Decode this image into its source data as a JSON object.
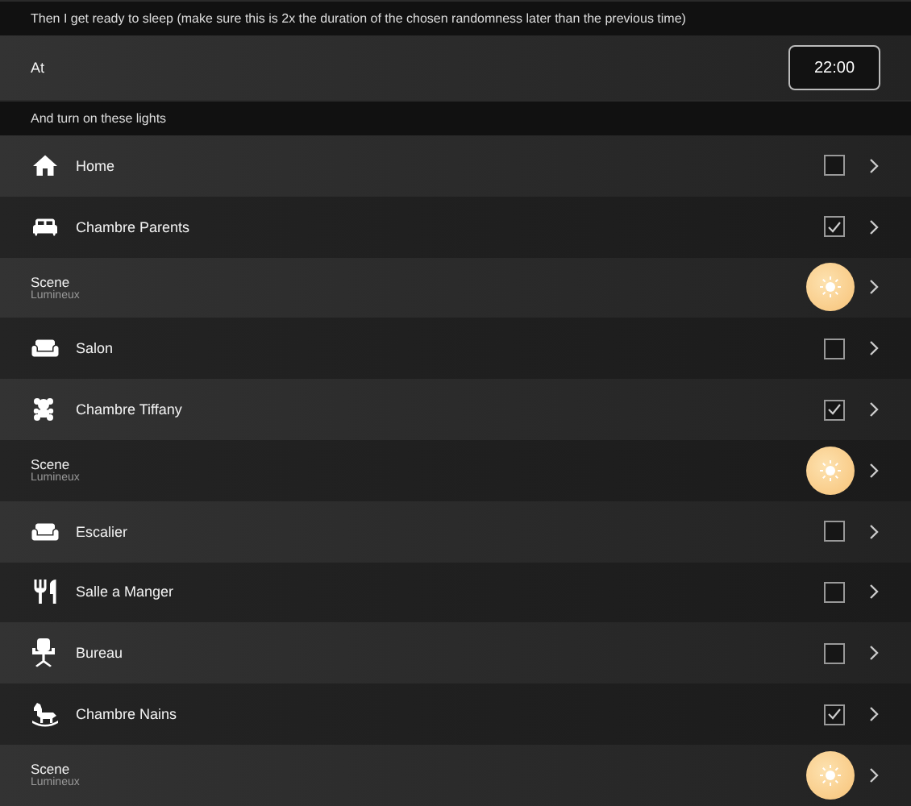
{
  "intro": "Then I get ready to sleep (make sure this is 2x the duration of the chosen randomness later than the previous time)",
  "time_row": {
    "label": "At",
    "value": "22:00"
  },
  "section": "And turn on these lights",
  "rows": [
    {
      "kind": "room",
      "name": "Home",
      "checked": false
    },
    {
      "kind": "room",
      "name": "Chambre Parents",
      "checked": true
    },
    {
      "kind": "scene",
      "name": "Scene",
      "subtitle": "Lumineux"
    },
    {
      "kind": "room",
      "name": "Salon",
      "checked": false
    },
    {
      "kind": "room",
      "name": "Chambre Tiffany",
      "checked": true
    },
    {
      "kind": "scene",
      "name": "Scene",
      "subtitle": "Lumineux"
    },
    {
      "kind": "room",
      "name": "Escalier",
      "checked": false
    },
    {
      "kind": "room",
      "name": "Salle a Manger",
      "checked": false
    },
    {
      "kind": "room",
      "name": "Bureau",
      "checked": false
    },
    {
      "kind": "room",
      "name": "Chambre Nains",
      "checked": true
    },
    {
      "kind": "scene",
      "name": "Scene",
      "subtitle": "Lumineux"
    }
  ]
}
